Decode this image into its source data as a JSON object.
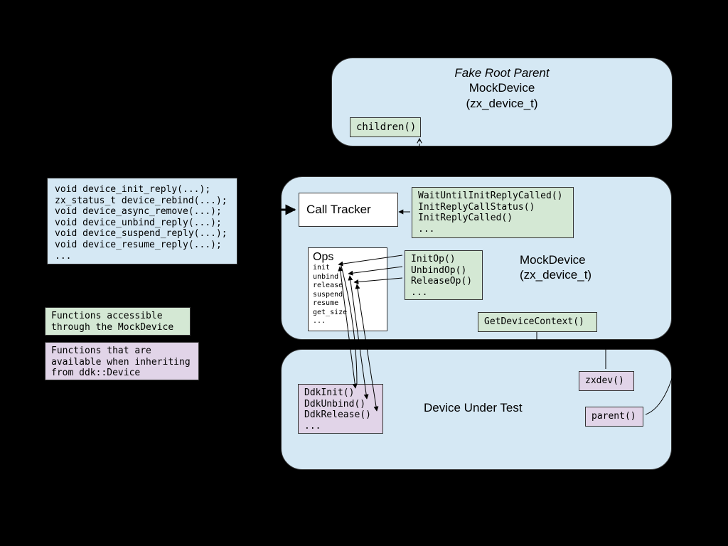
{
  "fakeRoot": {
    "titleItalic": "Fake Root Parent",
    "title2": "MockDevice",
    "title3": "(zx_device_t)",
    "children": "children()"
  },
  "apiList": {
    "l1": "void device_init_reply(...);",
    "l2": "zx_status_t device_rebind(...);",
    "l3": "void device_async_remove(...);",
    "l4": "void device_unbind_reply(...);",
    "l5": "void device_suspend_reply(...);",
    "l6": "void device_resume_reply(...);",
    "l7": "..."
  },
  "legend": {
    "green": "Functions accessible through the MockDevice",
    "purple": "Functions that are available when inheriting from ddk::Device"
  },
  "mock": {
    "callTracker": "Call Tracker",
    "wait": {
      "l1": "WaitUntilInitReplyCalled()",
      "l2": "InitReplyCallStatus()",
      "l3": "InitReplyCalled()",
      "l4": "..."
    },
    "title1": "MockDevice",
    "title2": "(zx_device_t)",
    "ops": {
      "title": "Ops",
      "l1": "init",
      "l2": "unbind",
      "l3": "release",
      "l4": "suspend",
      "l5": "resume",
      "l6": "get_size",
      "l7": "..."
    },
    "opsFns": {
      "l1": "InitOp()",
      "l2": "UnbindOp()",
      "l3": "ReleaseOp()",
      "l4": "..."
    },
    "getCtx": "GetDeviceContext()"
  },
  "dut": {
    "title": "Device Under Test",
    "ddk": {
      "l1": "DdkInit()",
      "l2": "DdkUnbind()",
      "l3": "DdkRelease()",
      "l4": "..."
    },
    "zxdev": "zxdev()",
    "parent": "parent()"
  }
}
